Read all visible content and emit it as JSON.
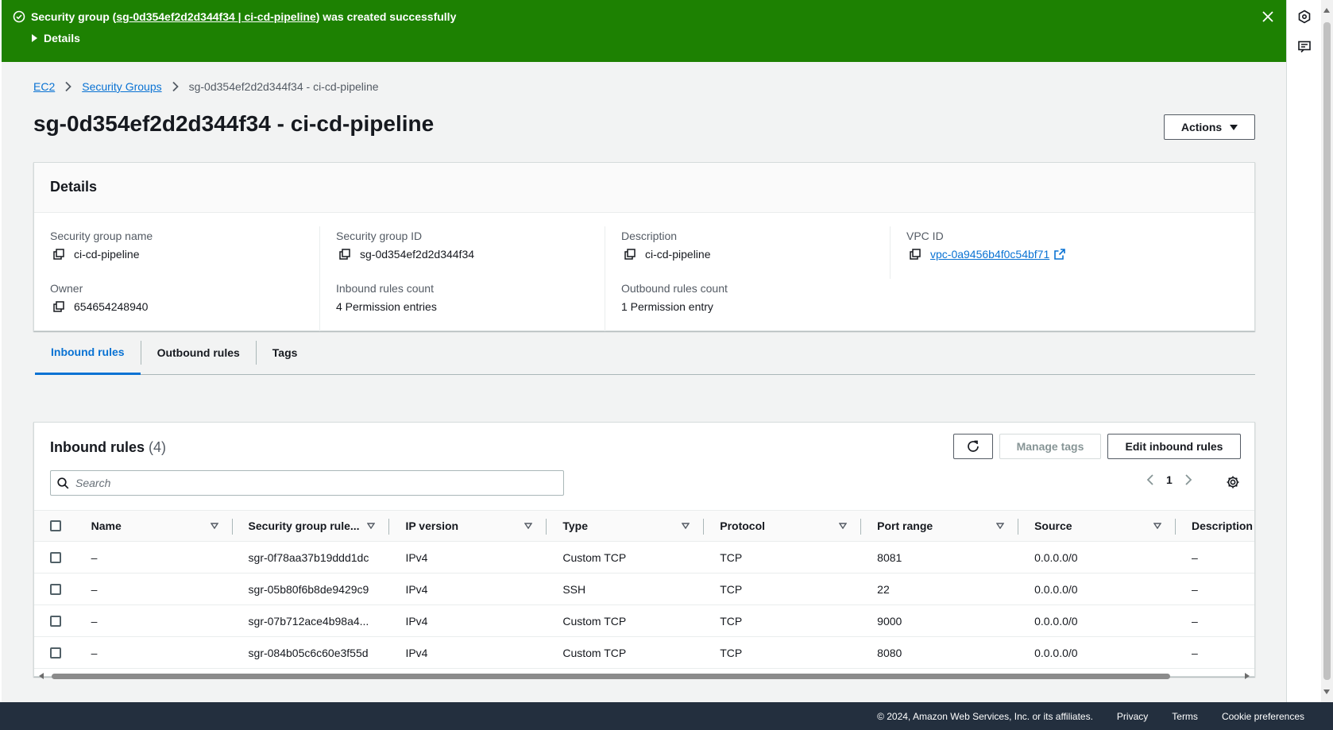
{
  "flash": {
    "prefix": "Security group (",
    "link": "sg-0d354ef2d2d344f34 | ci-cd-pipeline",
    "suffix": ") was created successfully",
    "details": "Details"
  },
  "breadcrumb": {
    "items": [
      "EC2",
      "Security Groups"
    ],
    "current": "sg-0d354ef2d2d344f34 - ci-cd-pipeline"
  },
  "page": {
    "title": "sg-0d354ef2d2d344f34 - ci-cd-pipeline",
    "actions_label": "Actions"
  },
  "details": {
    "header": "Details",
    "sg_name_label": "Security group name",
    "sg_name": "ci-cd-pipeline",
    "sg_id_label": "Security group ID",
    "sg_id": "sg-0d354ef2d2d344f34",
    "description_label": "Description",
    "description": "ci-cd-pipeline",
    "vpc_label": "VPC ID",
    "vpc_id": "vpc-0a9456b4f0c54bf71",
    "owner_label": "Owner",
    "owner": "654654248940",
    "inbound_count_label": "Inbound rules count",
    "inbound_count": "4 Permission entries",
    "outbound_count_label": "Outbound rules count",
    "outbound_count": "1 Permission entry"
  },
  "tabs": [
    "Inbound rules",
    "Outbound rules",
    "Tags"
  ],
  "rules": {
    "title": "Inbound rules",
    "count": "(4)",
    "manage_tags": "Manage tags",
    "edit_label": "Edit inbound rules",
    "search_placeholder": "Search",
    "page": "1",
    "columns": [
      "Name",
      "Security group rule...",
      "IP version",
      "Type",
      "Protocol",
      "Port range",
      "Source",
      "Description"
    ],
    "rows": [
      [
        "–",
        "sgr-0f78aa37b19ddd1dc",
        "IPv4",
        "Custom TCP",
        "TCP",
        "8081",
        "0.0.0.0/0",
        "–"
      ],
      [
        "–",
        "sgr-05b80f6b8de9429c9",
        "IPv4",
        "SSH",
        "TCP",
        "22",
        "0.0.0.0/0",
        "–"
      ],
      [
        "–",
        "sgr-07b712ace4b98a4...",
        "IPv4",
        "Custom TCP",
        "TCP",
        "9000",
        "0.0.0.0/0",
        "–"
      ],
      [
        "–",
        "sgr-084b05c6c60e3f55d",
        "IPv4",
        "Custom TCP",
        "TCP",
        "8080",
        "0.0.0.0/0",
        "–"
      ]
    ]
  },
  "footer": {
    "copyright": "© 2024, Amazon Web Services, Inc. or its affiliates.",
    "privacy": "Privacy",
    "terms": "Terms",
    "cookies": "Cookie preferences"
  },
  "colors": {
    "success": "#1d8102",
    "link": "#0972d3",
    "footer": "#232f3e"
  }
}
